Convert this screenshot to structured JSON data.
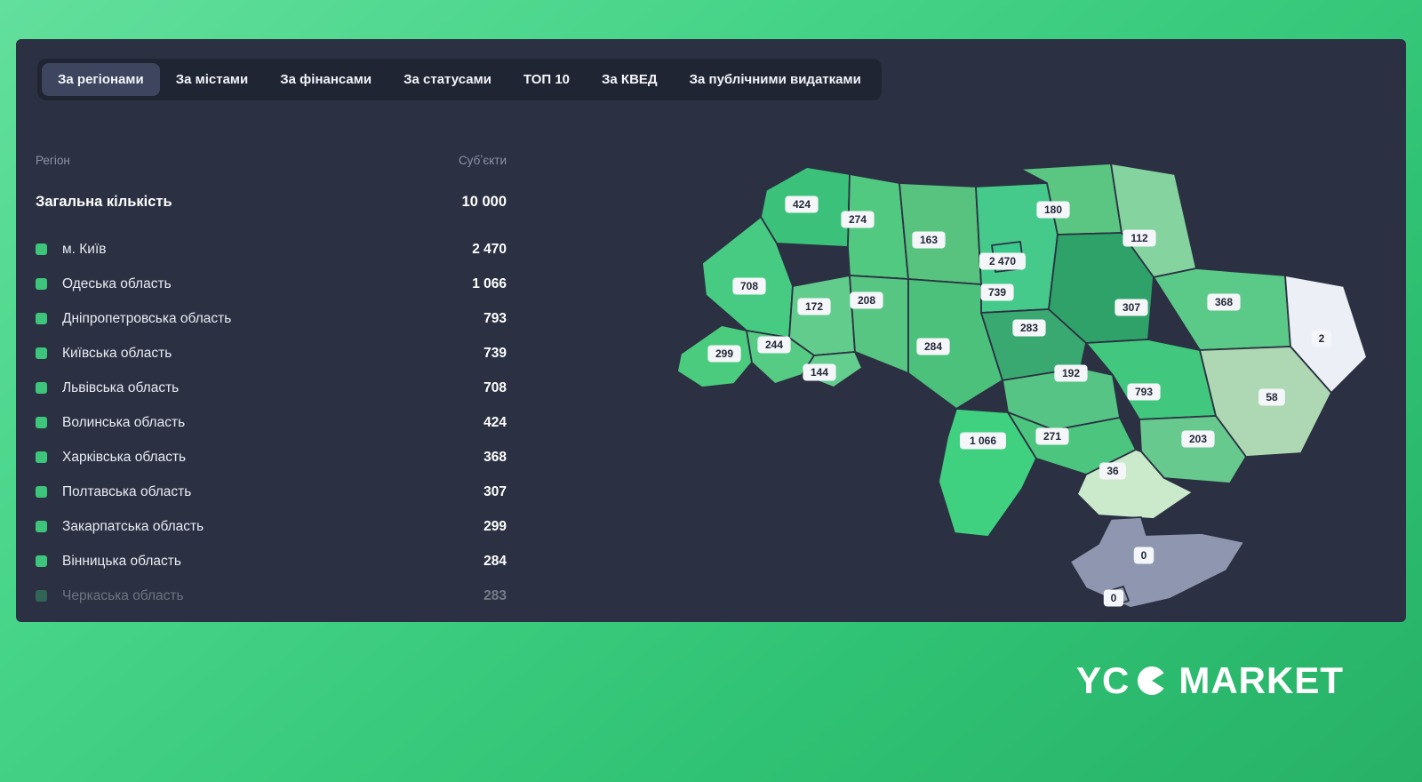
{
  "tabs": [
    {
      "id": "regions",
      "label": "За регіонами",
      "active": true
    },
    {
      "id": "cities",
      "label": "За містами",
      "active": false
    },
    {
      "id": "finances",
      "label": "За фінансами",
      "active": false
    },
    {
      "id": "statuses",
      "label": "За статусами",
      "active": false
    },
    {
      "id": "top-10",
      "label": "ТОП 10",
      "active": false
    },
    {
      "id": "kved",
      "label": "За КВЕД",
      "active": false
    },
    {
      "id": "public-spending",
      "label": "За публічними видатками",
      "active": false
    }
  ],
  "table": {
    "header_region": "Регіон",
    "header_subjects": "Субʼєкти",
    "total_label": "Загальна кількість",
    "total_value": "10 000",
    "bullet_color": "#3ec57c",
    "rows": [
      {
        "name": "м. Київ",
        "value": "2 470",
        "faded": false
      },
      {
        "name": "Одеська область",
        "value": "1 066",
        "faded": false
      },
      {
        "name": "Дніпропетровська область",
        "value": "793",
        "faded": false
      },
      {
        "name": "Київська область",
        "value": "739",
        "faded": false
      },
      {
        "name": "Львівська область",
        "value": "708",
        "faded": false
      },
      {
        "name": "Волинська область",
        "value": "424",
        "faded": false
      },
      {
        "name": "Харківська область",
        "value": "368",
        "faded": false
      },
      {
        "name": "Полтавська область",
        "value": "307",
        "faded": false
      },
      {
        "name": "Закарпатська область",
        "value": "299",
        "faded": false
      },
      {
        "name": "Вінницька область",
        "value": "284",
        "faded": false
      },
      {
        "name": "Черкаська область",
        "value": "283",
        "faded": true
      }
    ]
  },
  "map": {
    "stroke": "#2b3142",
    "label_bg": "#f4f6f9",
    "regions": [
      {
        "id": "volyn",
        "value": "424",
        "color": "#3cc17a"
      },
      {
        "id": "rivne",
        "value": "274",
        "color": "#52c981"
      },
      {
        "id": "zhytomyr",
        "value": "163",
        "color": "#58c37e"
      },
      {
        "id": "kyiv-oblast",
        "value": "739",
        "color": "#45ca8c"
      },
      {
        "id": "kyiv-city",
        "value": "2 470",
        "color": "#3cc98e"
      },
      {
        "id": "chernihiv",
        "value": "180",
        "color": "#5ac681"
      },
      {
        "id": "sumy",
        "value": "112",
        "color": "#85d39e"
      },
      {
        "id": "lviv",
        "value": "708",
        "color": "#47cb83"
      },
      {
        "id": "ternopil",
        "value": "172",
        "color": "#62cc8d"
      },
      {
        "id": "khmelnytskyi",
        "value": "208",
        "color": "#58c683"
      },
      {
        "id": "vinnytsia",
        "value": "284",
        "color": "#4cc17c"
      },
      {
        "id": "cherkasy",
        "value": "283",
        "color": "#3aa971"
      },
      {
        "id": "poltava",
        "value": "307",
        "color": "#2fa26a"
      },
      {
        "id": "kharkiv",
        "value": "368",
        "color": "#5bca88"
      },
      {
        "id": "luhansk",
        "value": "2",
        "color": "#edeff6"
      },
      {
        "id": "zakarpattia",
        "value": "299",
        "color": "#4bcb7e"
      },
      {
        "id": "ivano-frankivsk",
        "value": "244",
        "color": "#55cb84"
      },
      {
        "id": "chernivtsi",
        "value": "144",
        "color": "#64ce8f"
      },
      {
        "id": "kirovohrad",
        "value": "192",
        "color": "#56c484"
      },
      {
        "id": "dnipro",
        "value": "793",
        "color": "#41c87e"
      },
      {
        "id": "donetsk",
        "value": "58",
        "color": "#aed8b3"
      },
      {
        "id": "odesa",
        "value": "1 066",
        "color": "#3fd080"
      },
      {
        "id": "mykolaiv",
        "value": "271",
        "color": "#4cc67e"
      },
      {
        "id": "kherson",
        "value": "36",
        "color": "#cbe9cb"
      },
      {
        "id": "zaporizhzhia",
        "value": "203",
        "color": "#67c98e"
      },
      {
        "id": "crimea",
        "value": "0",
        "color": "#8f97b0"
      },
      {
        "id": "sevastopol",
        "value": "0",
        "color": "#8f97b0"
      }
    ]
  },
  "logo": {
    "yc": "YC",
    "market": "MARKET"
  }
}
